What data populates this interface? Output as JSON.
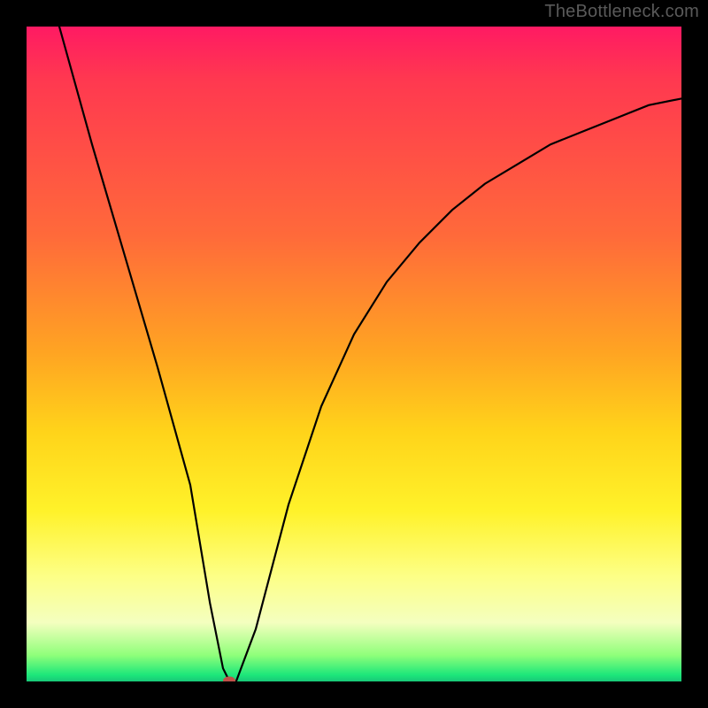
{
  "watermark": "TheBottleneck.com",
  "chart_data": {
    "type": "line",
    "title": "",
    "xlabel": "",
    "ylabel": "",
    "xlim": [
      0,
      100
    ],
    "ylim": [
      0,
      100
    ],
    "grid": false,
    "series": [
      {
        "name": "curve",
        "x": [
          5,
          10,
          15,
          20,
          25,
          28,
          30,
          31,
          32,
          35,
          40,
          45,
          50,
          55,
          60,
          65,
          70,
          75,
          80,
          85,
          90,
          95,
          100
        ],
        "values": [
          100,
          82,
          65,
          48,
          30,
          12,
          2,
          0,
          0,
          8,
          27,
          42,
          53,
          61,
          67,
          72,
          76,
          79,
          82,
          84,
          86,
          88,
          89
        ]
      }
    ],
    "marker": {
      "x": 31,
      "y": 0,
      "color": "#c05048"
    },
    "background_gradient": {
      "direction": "vertical",
      "stops": [
        {
          "pos": 0,
          "color": "#ff1a63"
        },
        {
          "pos": 8,
          "color": "#ff3850"
        },
        {
          "pos": 32,
          "color": "#ff6a3a"
        },
        {
          "pos": 50,
          "color": "#ffa522"
        },
        {
          "pos": 62,
          "color": "#ffd41a"
        },
        {
          "pos": 74,
          "color": "#fff22a"
        },
        {
          "pos": 84,
          "color": "#fdff87"
        },
        {
          "pos": 91,
          "color": "#f4ffbf"
        },
        {
          "pos": 96,
          "color": "#8fff7a"
        },
        {
          "pos": 99,
          "color": "#1de77a"
        },
        {
          "pos": 100,
          "color": "#18c878"
        }
      ]
    }
  }
}
